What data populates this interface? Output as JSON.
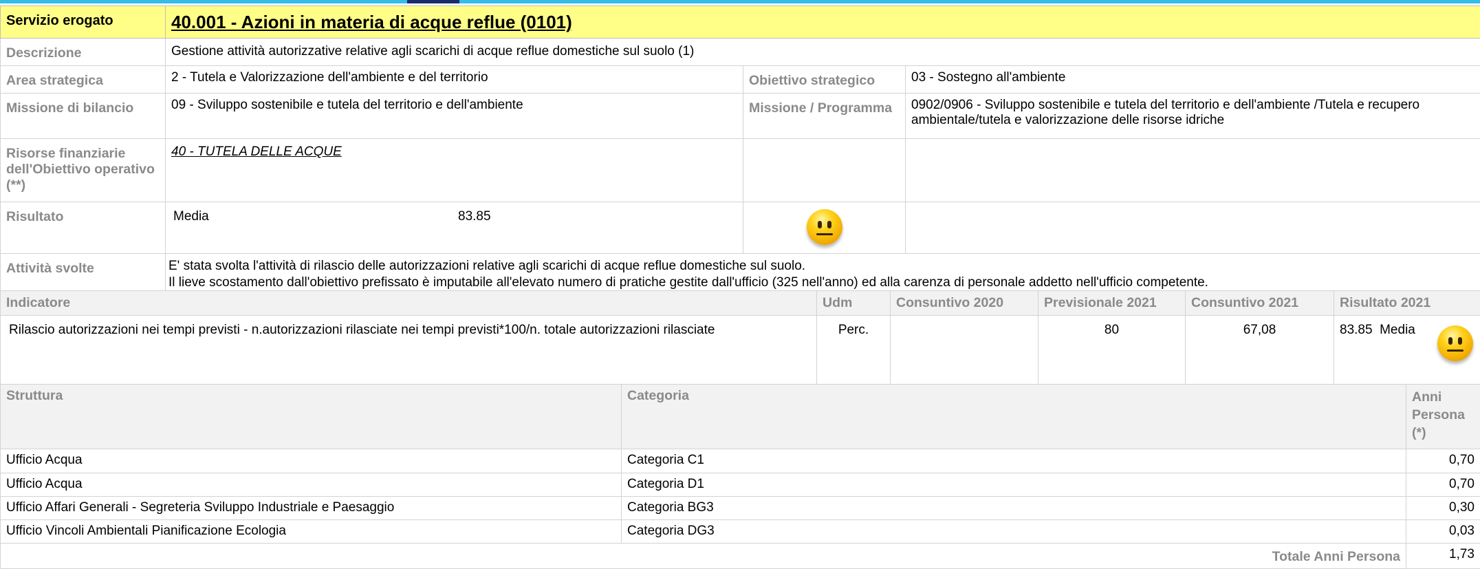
{
  "service": {
    "label": "Servizio erogato",
    "title": "40.001 - Azioni in materia di acque reflue (0101)"
  },
  "details": {
    "descrizione_label": "Descrizione",
    "descrizione_value": "Gestione attività autorizzative relative agli scarichi di acque reflue domestiche sul suolo (1)",
    "area_label": "Area strategica",
    "area_value": "2 - Tutela e Valorizzazione dell'ambiente e del territorio",
    "obiettivo_label": "Obiettivo strategico",
    "obiettivo_value": "03 - Sostegno all'ambiente",
    "missione_label": "Missione di bilancio",
    "missione_value": "09 - Sviluppo sostenibile e tutela del territorio e dell'ambiente",
    "programma_label": "Missione / Programma",
    "programma_value": "0902/0906 - Sviluppo sostenibile e tutela del territorio e dell'ambiente /Tutela e recupero ambientale/tutela e valorizzazione delle risorse idriche",
    "risorse_label": "Risorse finanziarie dell'Obiettivo operativo (**)",
    "risorse_value": "40 - TUTELA DELLE ACQUE",
    "risultato_label": "Risultato",
    "risultato_rating": "Media",
    "risultato_score": "83.85",
    "risultato_icon": "neutral-face-icon",
    "attivita_label": "Attività svolte",
    "attivita_line1": "E' stata svolta l'attività di rilascio delle autorizzazioni relative agli scarichi di acque reflue domestiche sul suolo.",
    "attivita_line2": "Il lieve scostamento dall'obiettivo prefissato è imputabile all'elevato numero di pratiche gestite dall'ufficio (325 nell'anno) ed alla carenza di personale addetto nell'ufficio competente."
  },
  "indicators": {
    "headers": [
      "Indicatore",
      "Udm",
      "Consuntivo 2020",
      "Previsionale 2021",
      "Consuntivo 2021",
      "Risultato 2021"
    ],
    "rows": [
      {
        "indicatore": "Rilascio autorizzazioni nei tempi previsti - n.autorizzazioni rilasciate nei tempi  previsti*100/n. totale autorizzazioni rilasciate",
        "udm": "Perc.",
        "consuntivo_2020": "",
        "previsionale_2021": "80",
        "consuntivo_2021": "67,08",
        "risultato_score": "83.85",
        "risultato_rating": "Media",
        "risultato_icon": "neutral-face-icon"
      }
    ]
  },
  "staff": {
    "headers": [
      "Struttura",
      "Categoria",
      "Anni Persona (*)"
    ],
    "rows": [
      {
        "struttura": "Ufficio Acqua",
        "categoria": "Categoria C1",
        "anni": "0,70"
      },
      {
        "struttura": "Ufficio Acqua",
        "categoria": "Categoria D1",
        "anni": "0,70"
      },
      {
        "struttura": "Ufficio Affari Generali - Segreteria Sviluppo Industriale e Paesaggio",
        "categoria": "Categoria BG3",
        "anni": "0,30"
      },
      {
        "struttura": "Ufficio Vincoli Ambientali Pianificazione Ecologia",
        "categoria": "Categoria DG3",
        "anni": "0,03"
      }
    ],
    "total_label": "Totale Anni Persona",
    "total_value": "1,73"
  },
  "colors": {
    "header_bar": "#ffff88",
    "top_accent": "#33bde8",
    "label_gray": "#8a8a8a"
  }
}
